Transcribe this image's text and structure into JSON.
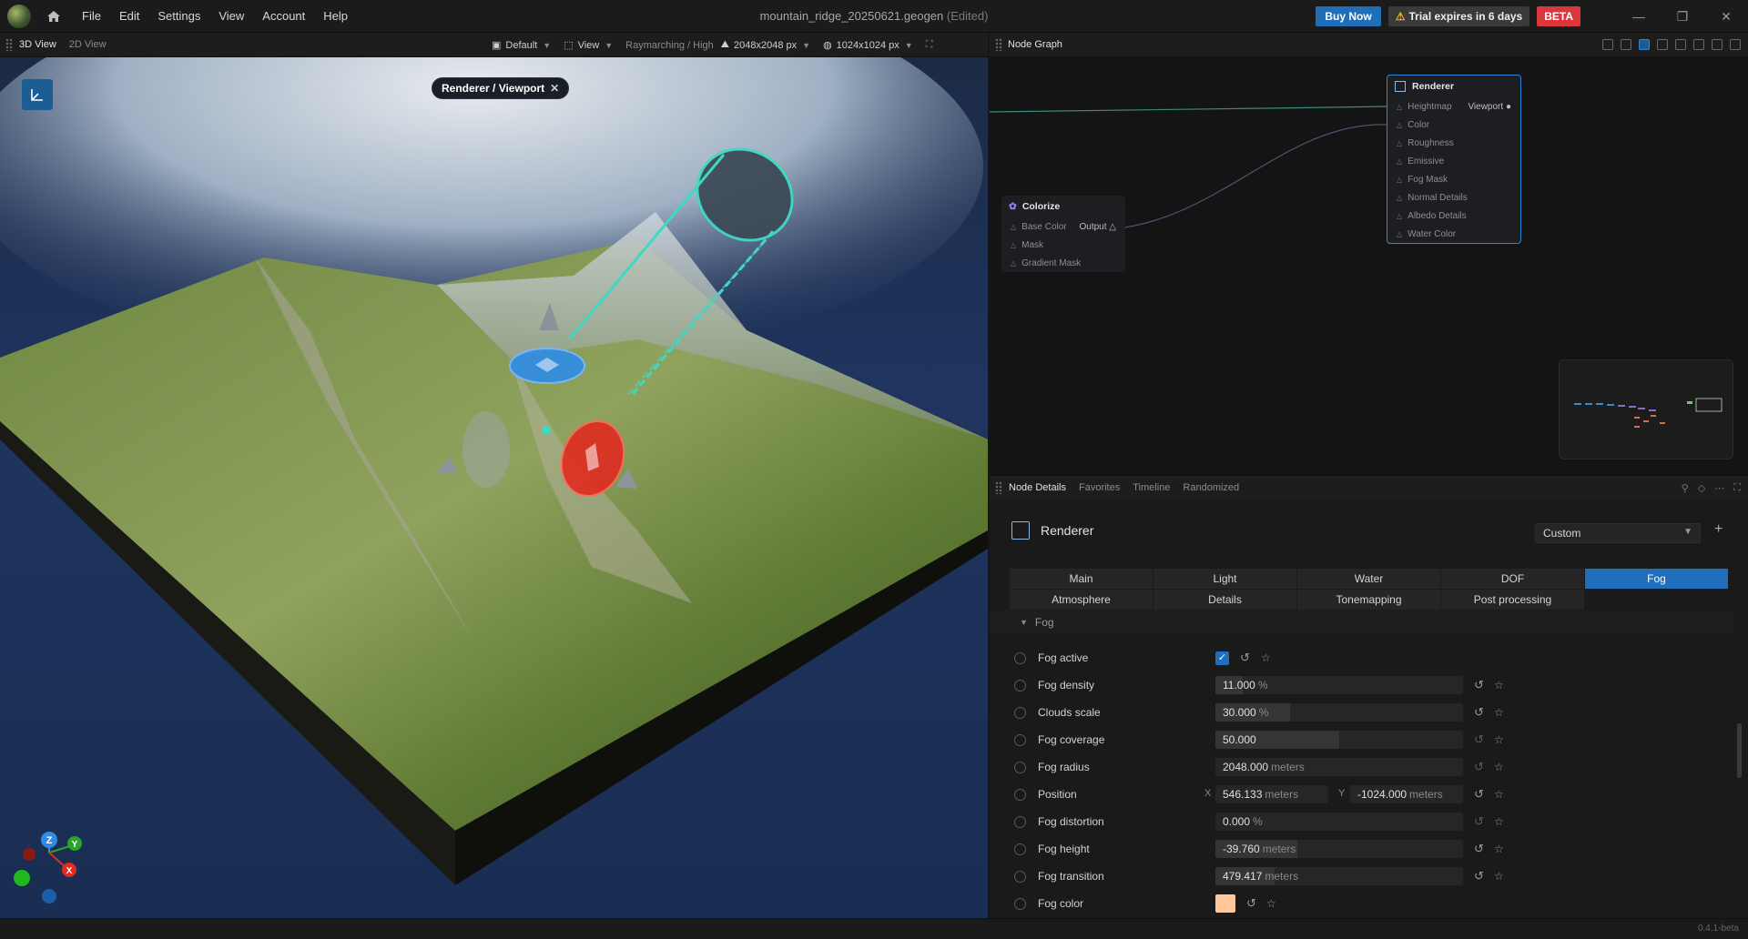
{
  "menu": [
    "File",
    "Edit",
    "Settings",
    "View",
    "Account",
    "Help"
  ],
  "document": {
    "name": "mountain_ridge_20250621.geogen",
    "status": "(Edited)"
  },
  "titlebar": {
    "buy": "Buy Now",
    "trial": "Trial expires in 6 days",
    "beta": "BETA"
  },
  "viewport_header": {
    "tabs": [
      "3D View",
      "2D View"
    ],
    "camera": "Default",
    "view": "View",
    "render_mode": "Raymarching / High",
    "resolution": "2048x2048 px",
    "texture_res": "1024x1024 px"
  },
  "viewport": {
    "breadcrumb": "Renderer / Viewport",
    "gizmo": {
      "z": "Z",
      "y": "Y",
      "x": "X"
    }
  },
  "node_graph": {
    "title": "Node Graph",
    "renderer": {
      "title": "Renderer",
      "inputs": [
        "Heightmap",
        "Color",
        "Roughness",
        "Emissive",
        "Fog Mask",
        "Normal Details",
        "Albedo Details",
        "Water Color"
      ],
      "output": "Viewport"
    },
    "colorize": {
      "title": "Colorize",
      "inputs": [
        "Base Color",
        "Mask",
        "Gradient Mask"
      ],
      "output": "Output"
    }
  },
  "details_header": {
    "tabs": [
      "Node Details",
      "Favorites",
      "Timeline",
      "Randomized"
    ]
  },
  "details": {
    "node_name": "Renderer",
    "preset": "Custom",
    "tabs_row1": [
      "Main",
      "Light",
      "Water",
      "DOF",
      "Fog"
    ],
    "tabs_row2": [
      "Atmosphere",
      "Details",
      "Tonemapping",
      "Post processing"
    ],
    "active_tab": "Fog",
    "section": "Fog",
    "props": {
      "fog_active": {
        "label": "Fog active",
        "checked": true
      },
      "fog_density": {
        "label": "Fog density",
        "value": "11.000",
        "unit": "%",
        "fill": 0.11
      },
      "clouds_scale": {
        "label": "Clouds scale",
        "value": "30.000",
        "unit": "%",
        "fill": 0.3
      },
      "fog_coverage": {
        "label": "Fog coverage",
        "value": "50.000",
        "unit": "",
        "fill": 0.5
      },
      "fog_radius": {
        "label": "Fog radius",
        "value": "2048.000",
        "unit": "meters",
        "fill": 0.0
      },
      "position": {
        "label": "Position",
        "x_label": "X",
        "x": "546.133",
        "y_label": "Y",
        "y": "-1024.000",
        "unit": "meters"
      },
      "fog_distortion": {
        "label": "Fog distortion",
        "value": "0.000",
        "unit": "%",
        "fill": 0.0
      },
      "fog_height": {
        "label": "Fog height",
        "value": "-39.760",
        "unit": "meters",
        "fill": 0.33
      },
      "fog_transition": {
        "label": "Fog transition",
        "value": "479.417",
        "unit": "meters",
        "fill": 0.24
      },
      "fog_color": {
        "label": "Fog color",
        "color": "#ffc79a"
      }
    }
  },
  "version": "0.4.1-beta",
  "colors": {
    "accent": "#1f6fbd",
    "beta": "#d9363e",
    "gizmo_cyan": "#3fd9c2",
    "gizmo_blue": "#2f8ce6",
    "gizmo_red": "#e02b20"
  }
}
